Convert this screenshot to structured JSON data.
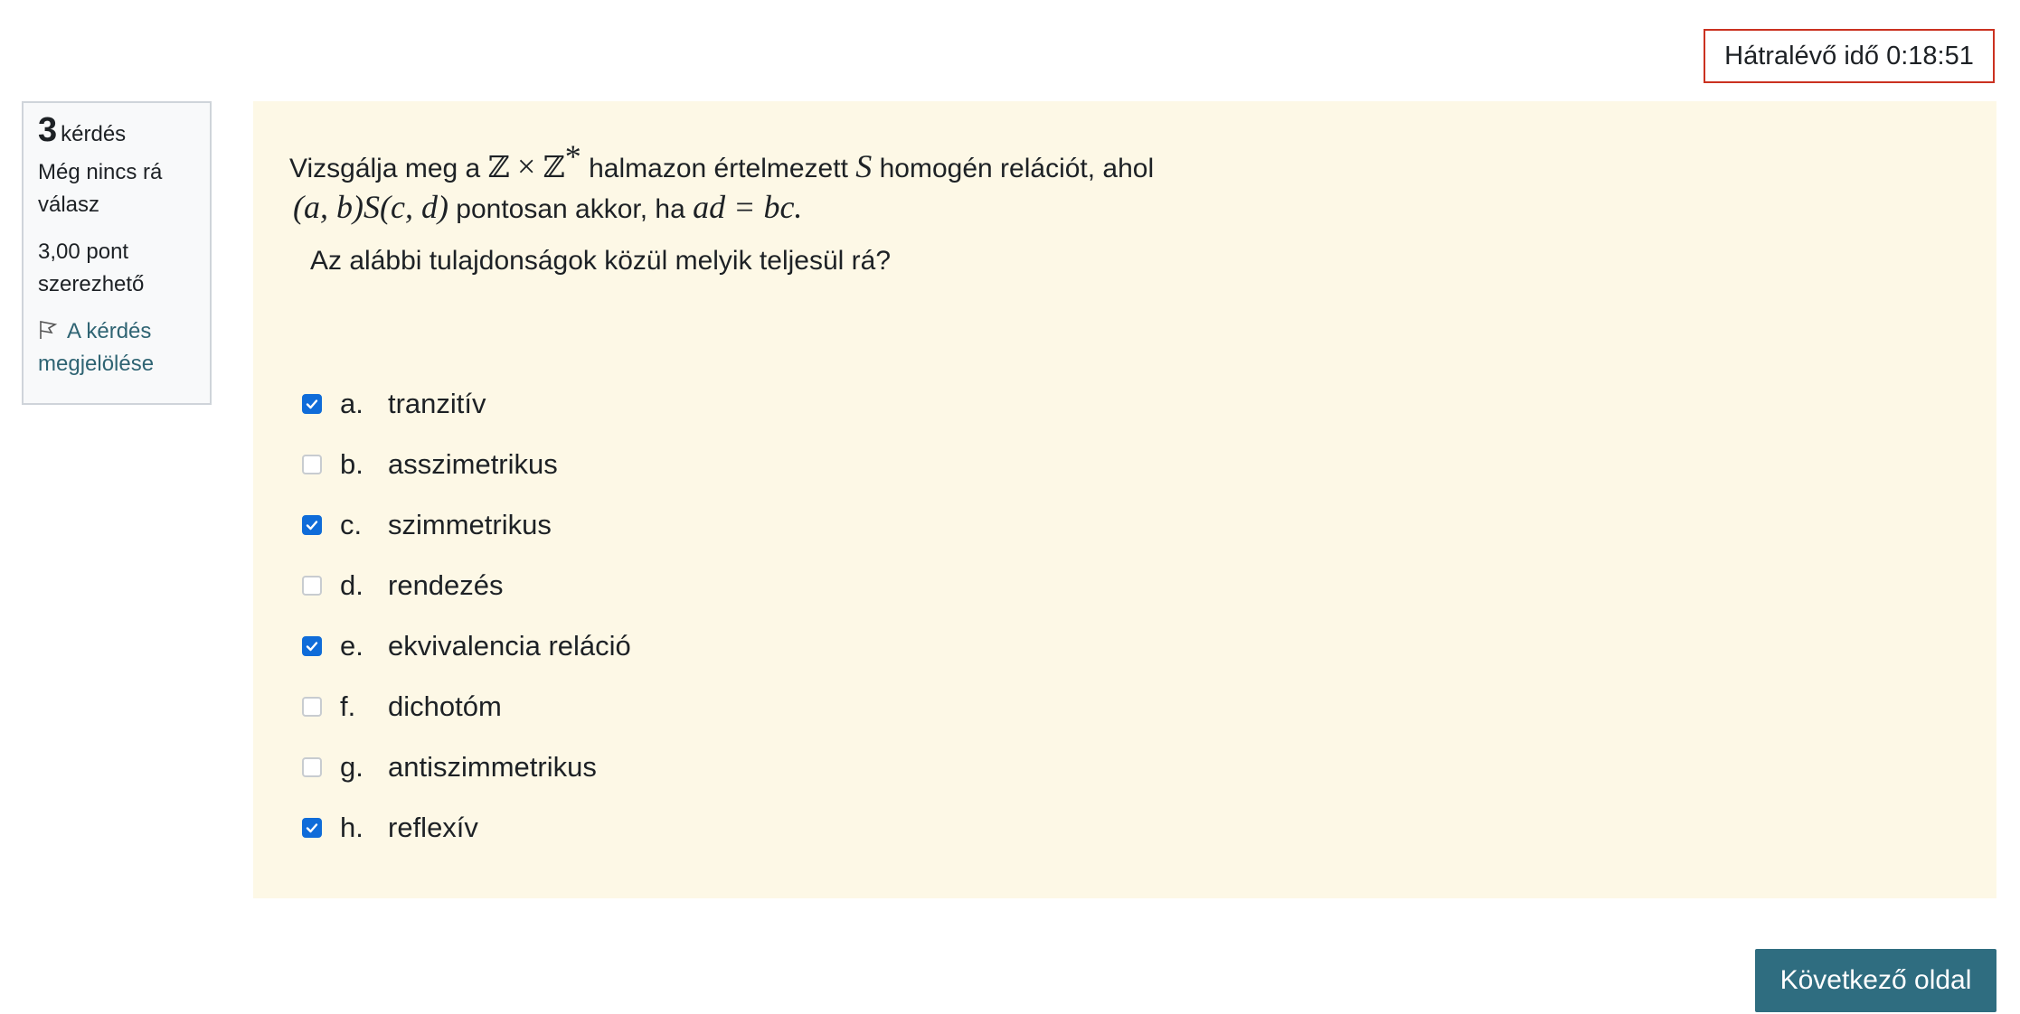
{
  "timer": {
    "text": "Hátralévő idő 0:18:51"
  },
  "question_info": {
    "number": "3",
    "number_label": "kérdés",
    "state": "Még nincs rá válasz",
    "grade": "3,00 pont szerezhető",
    "flag_label": "A kérdés megjelölése"
  },
  "question": {
    "line1_a": "Vizsgálja meg a",
    "set_left": "ℤ",
    "times": "×",
    "set_right": "ℤ",
    "star": "*",
    "line1_b": "halmazon értelmezett",
    "rel": "S",
    "line1_c": "homogén relációt, ahol",
    "formula_left": "(a, b)S(c, d)",
    "line2_a": "pontosan akkor, ha",
    "formula_right": "ad = bc.",
    "line3": "Az alábbi tulajdonságok közül melyik teljesül rá?"
  },
  "answers": [
    {
      "letter": "a.",
      "text": "tranzitív",
      "checked": true
    },
    {
      "letter": "b.",
      "text": "asszimetrikus",
      "checked": false
    },
    {
      "letter": "c.",
      "text": "szimmetrikus",
      "checked": true
    },
    {
      "letter": "d.",
      "text": "rendezés",
      "checked": false
    },
    {
      "letter": "e.",
      "text": "ekvivalencia reláció",
      "checked": true
    },
    {
      "letter": "f.",
      "text": "dichotóm",
      "checked": false
    },
    {
      "letter": "g.",
      "text": "antiszimmetrikus",
      "checked": false
    },
    {
      "letter": "h.",
      "text": "reflexív",
      "checked": true
    }
  ],
  "next_button": {
    "label": "Következő oldal"
  },
  "colors": {
    "timer_border": "#ca3120",
    "content_bg": "#fdf8e6",
    "checkbox_checked": "#0f6cd9",
    "link": "#2f6473",
    "button_bg": "#2f6d80"
  }
}
